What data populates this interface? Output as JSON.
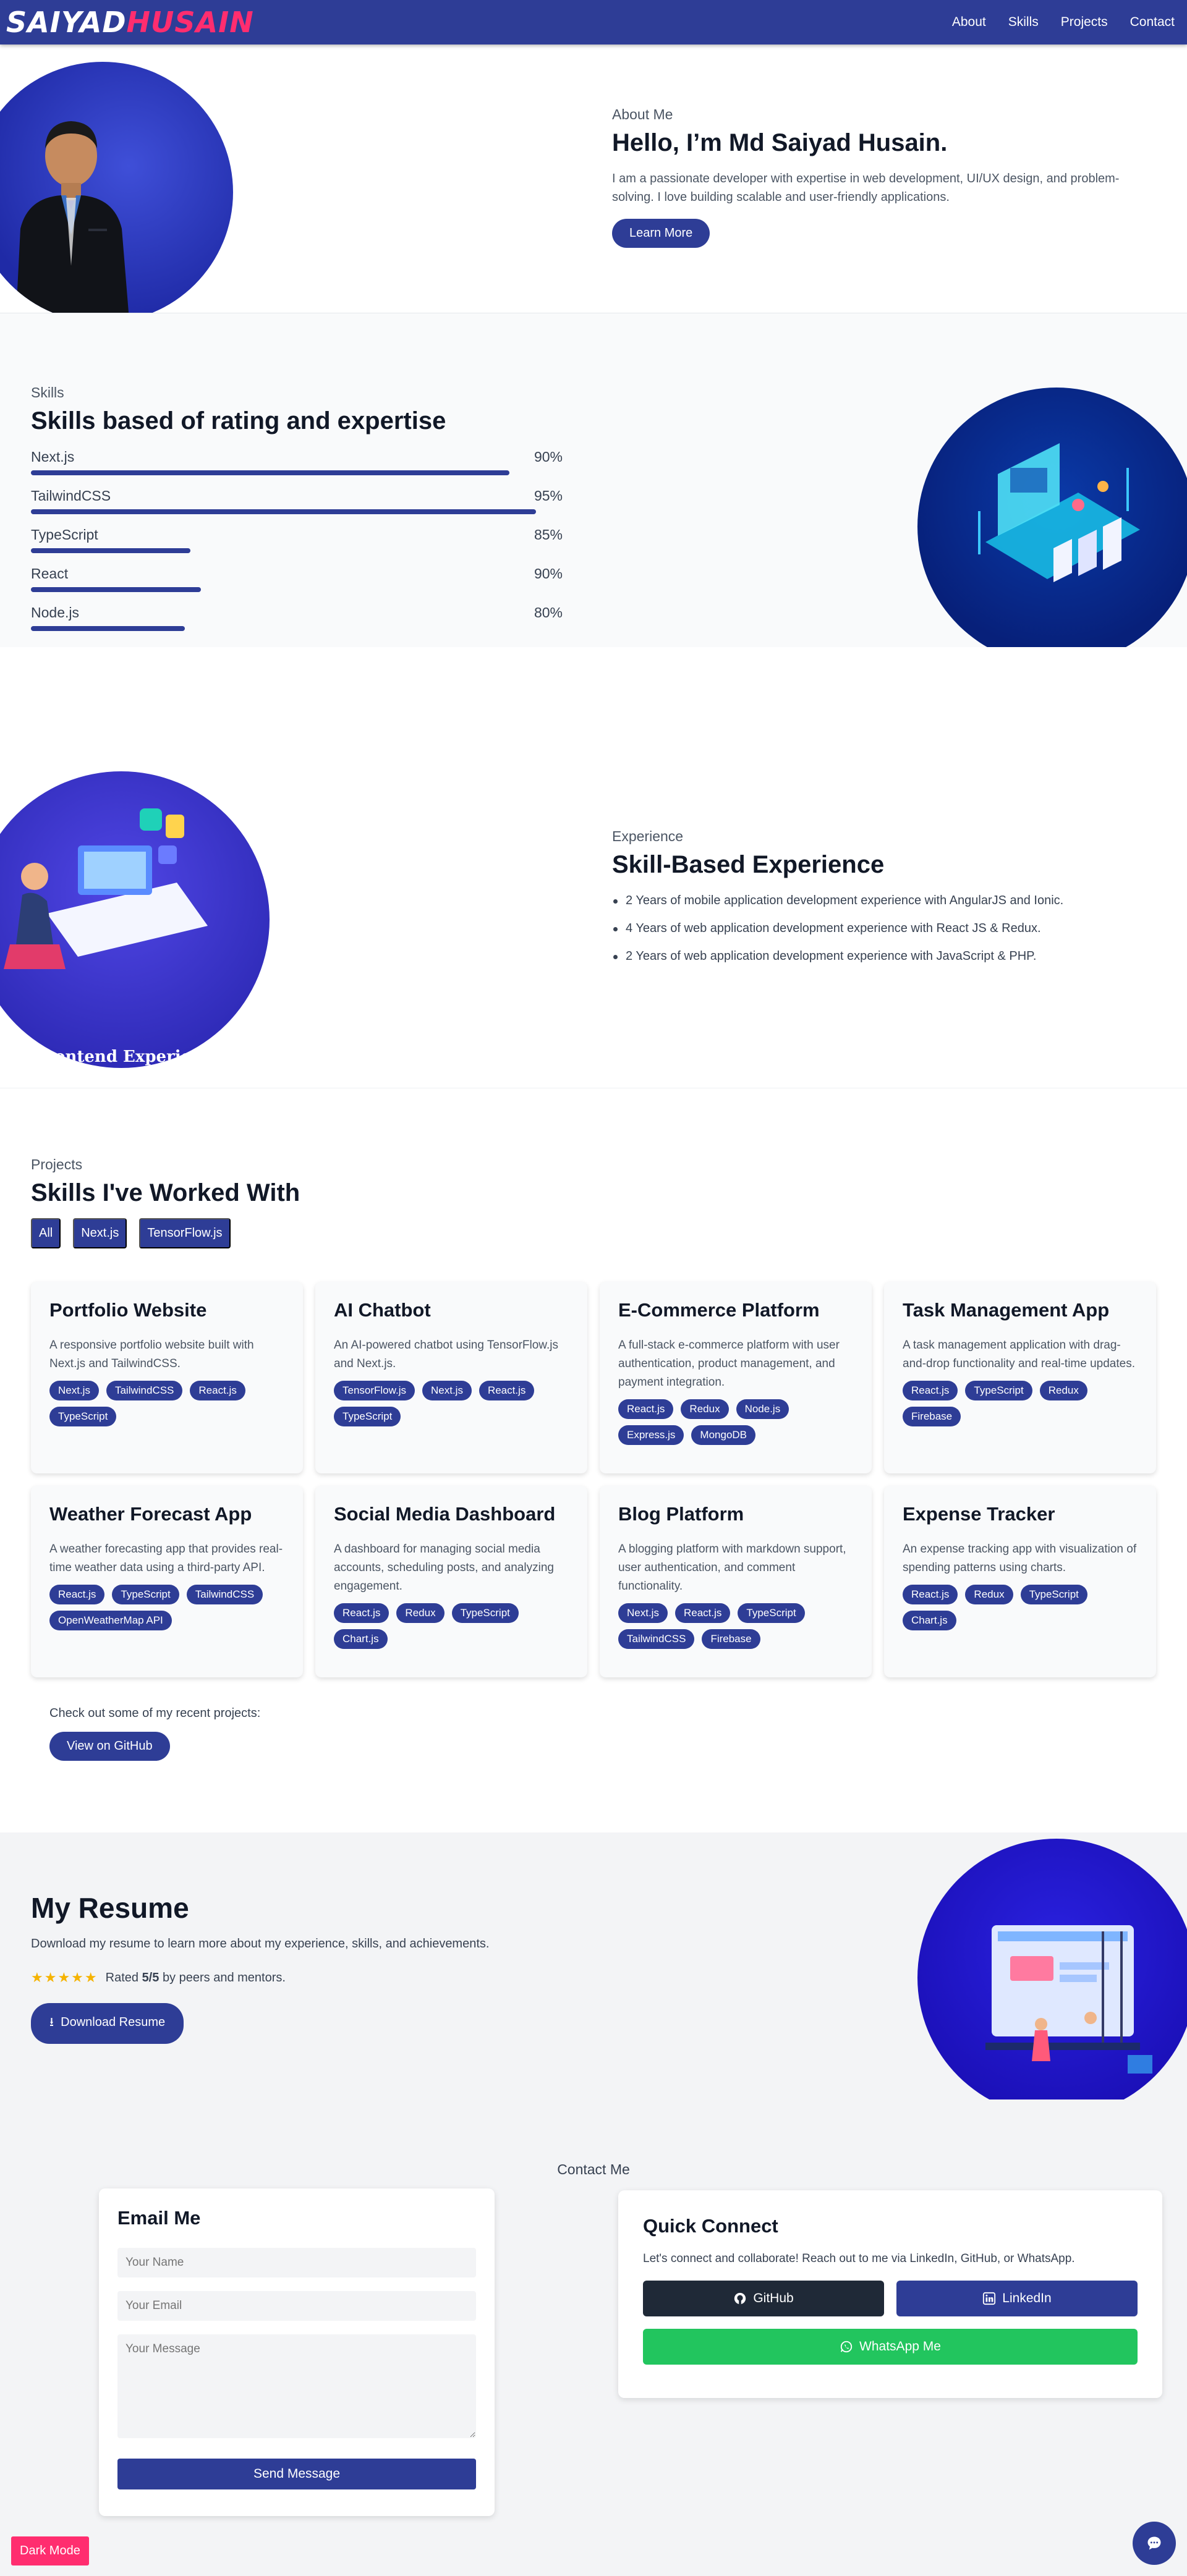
{
  "brand": {
    "part1": "SAIYAD",
    "part2": "HUSAIN",
    "accent": "#ff2d6f",
    "primary": "#2e3d96"
  },
  "nav": {
    "items": [
      "About",
      "Skills",
      "Projects",
      "Contact"
    ]
  },
  "about": {
    "label": "About Me",
    "heading": "Hello, I’m Md Saiyad Husain.",
    "description": "I am a passionate developer with expertise in web development, UI/UX design, and problem-solving. I love building scalable and user-friendly applications.",
    "button": "Learn More"
  },
  "skills": {
    "label": "Skills",
    "heading": "Skills based of rating and expertise",
    "items": [
      {
        "name": "Next.js",
        "percent": "90%",
        "bar_fill": 0.9
      },
      {
        "name": "TailwindCSS",
        "percent": "95%",
        "bar_fill": 0.95
      },
      {
        "name": "TypeScript",
        "percent": "85%",
        "bar_fill": 0.3
      },
      {
        "name": "React",
        "percent": "90%",
        "bar_fill": 0.32
      },
      {
        "name": "Node.js",
        "percent": "80%",
        "bar_fill": 0.29
      }
    ]
  },
  "experience": {
    "label": "Experience",
    "heading": "Skill-Based Experience",
    "image_caption": "UI & Frontend Experience",
    "items": [
      "2 Years of mobile application development experience with AngularJS and Ionic.",
      "4 Years of web application development experience with React JS & Redux.",
      "2 Years of web application development experience with JavaScript & PHP."
    ]
  },
  "projects": {
    "label": "Projects",
    "heading": "Skills I've Worked With",
    "filters": [
      "All",
      "Next.js",
      "TensorFlow.js"
    ],
    "cards": [
      {
        "title": "Portfolio Website",
        "description": "A responsive portfolio website built with Next.js and TailwindCSS.",
        "tags": [
          "Next.js",
          "TailwindCSS",
          "React.js",
          "TypeScript"
        ]
      },
      {
        "title": "AI Chatbot",
        "description": "An AI-powered chatbot using TensorFlow.js and Next.js.",
        "tags": [
          "TensorFlow.js",
          "Next.js",
          "React.js",
          "TypeScript"
        ]
      },
      {
        "title": "E-Commerce Platform",
        "description": "A full-stack e-commerce platform with user authentication, product management, and payment integration.",
        "tags": [
          "React.js",
          "Redux",
          "Node.js",
          "Express.js",
          "MongoDB"
        ]
      },
      {
        "title": "Task Management App",
        "description": "A task management application with drag-and-drop functionality and real-time updates.",
        "tags": [
          "React.js",
          "TypeScript",
          "Redux",
          "Firebase"
        ]
      },
      {
        "title": "Weather Forecast App",
        "description": "A weather forecasting app that provides real-time weather data using a third-party API.",
        "tags": [
          "React.js",
          "TypeScript",
          "TailwindCSS",
          "OpenWeatherMap API"
        ]
      },
      {
        "title": "Social Media Dashboard",
        "description": "A dashboard for managing social media accounts, scheduling posts, and analyzing engagement.",
        "tags": [
          "React.js",
          "Redux",
          "TypeScript",
          "Chart.js"
        ]
      },
      {
        "title": "Blog Platform",
        "description": "A blogging platform with markdown support, user authentication, and comment functionality.",
        "tags": [
          "Next.js",
          "React.js",
          "TypeScript",
          "TailwindCSS",
          "Firebase"
        ]
      },
      {
        "title": "Expense Tracker",
        "description": "An expense tracking app with visualization of spending patterns using charts.",
        "tags": [
          "React.js",
          "Redux",
          "TypeScript",
          "Chart.js"
        ]
      }
    ],
    "github_text": "Check out some of my recent projects:",
    "github_button": "View on GitHub"
  },
  "resume": {
    "heading": "My Resume",
    "description": "Download my resume to learn more about my experience, skills, and achievements.",
    "stars": "★★★★★",
    "rating_prefix": "Rated",
    "rating_value": "5/5",
    "rating_suffix": "by peers and mentors.",
    "button": "Download Resume"
  },
  "contact": {
    "label": "Contact Me",
    "email_heading": "Email Me",
    "name_placeholder": "Your Name",
    "email_placeholder": "Your Email",
    "message_placeholder": "Your Message",
    "send_button": "Send Message",
    "quick_heading": "Quick Connect",
    "quick_text": "Let's connect and collaborate! Reach out to me via LinkedIn, GitHub, or WhatsApp.",
    "github_button": "GitHub",
    "linkedin_button": "LinkedIn",
    "whatsapp_button": "WhatsApp Me"
  },
  "floating": {
    "dark_mode": "Dark Mode",
    "chat_icon": "chat-icon"
  }
}
